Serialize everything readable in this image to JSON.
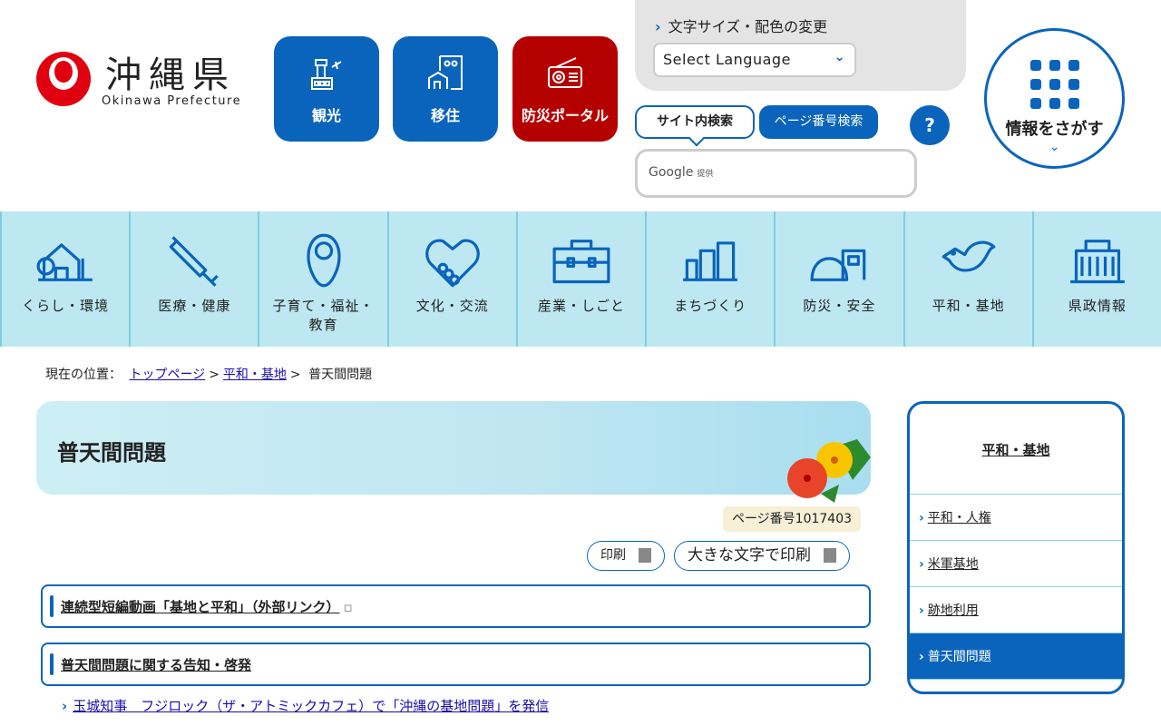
{
  "logo": {
    "title": "沖縄県",
    "subtitle": "Okinawa Prefecture"
  },
  "quick_links": [
    {
      "label": "観光",
      "icon": "control-tower-icon"
    },
    {
      "label": "移住",
      "icon": "building-house-icon"
    },
    {
      "label": "防災ポータル",
      "icon": "radio-icon"
    }
  ],
  "utility": {
    "text_size_label": "文字サイズ・配色の変更",
    "language_select": "Select Language",
    "search_tab_site": "サイト内検索",
    "search_tab_page": "ページ番号検索",
    "help": "?",
    "search_provider": "Google",
    "search_provider_suffix": "提供",
    "find_info": "情報をさがす"
  },
  "nav": [
    {
      "label": "くらし・環境"
    },
    {
      "label": "医療・健康"
    },
    {
      "label": "子育て・福祉・教育"
    },
    {
      "label": "文化・交流"
    },
    {
      "label": "産業・しごと"
    },
    {
      "label": "まちづくり"
    },
    {
      "label": "防災・安全"
    },
    {
      "label": "平和・基地"
    },
    {
      "label": "県政情報"
    }
  ],
  "breadcrumb": {
    "prefix": "現在の位置：",
    "items": [
      "トップページ",
      "平和・基地"
    ],
    "current": "普天間問題",
    "sep": ">"
  },
  "page": {
    "title": "普天間問題",
    "page_number": "ページ番号1017403",
    "print": "印刷",
    "print_large": "大きな文字で印刷",
    "sections": [
      {
        "title": "連続型短編動画「基地と平和」（外部リンク）"
      },
      {
        "title": "普天間問題に関する告知・啓発"
      }
    ],
    "links": [
      "玉城知事　フジロック（ザ・アトミックカフェ）で「沖縄の基地問題」を発信"
    ]
  },
  "sidebar": {
    "title": "平和・基地",
    "items": [
      {
        "label": "平和・人権"
      },
      {
        "label": "米軍基地"
      },
      {
        "label": "跡地利用"
      },
      {
        "label": "普天間問題"
      }
    ]
  },
  "colors": {
    "primary": "#0a64bc",
    "disaster": "#b50000",
    "logo_red": "#e0000f",
    "nav_bg": "#bde8f2"
  }
}
